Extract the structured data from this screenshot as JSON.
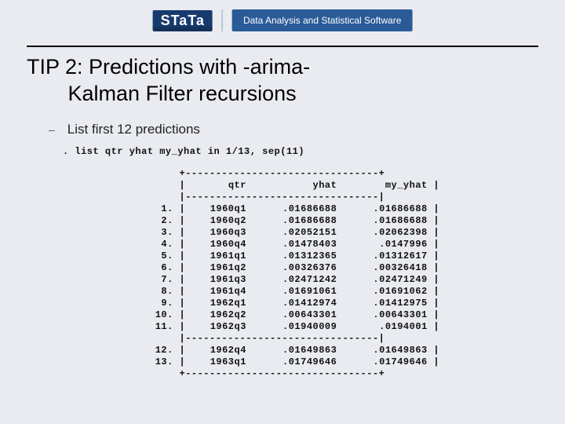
{
  "header": {
    "brand_upper": "STaTa",
    "tagline": "Data Analysis and Statistical Software"
  },
  "title_line1": "TIP 2: Predictions with -arima-",
  "title_line2": "Kalman Filter recursions",
  "bullet": "List first 12 predictions",
  "command": ". list qtr yhat my_yhat in 1/13, sep(11)",
  "table": {
    "border_top": "+--------------------------------+",
    "border_mid": "|--------------------------------|",
    "border_bot": "+--------------------------------+",
    "pipe": "|",
    "headers": {
      "qtr": "qtr",
      "yhat": "yhat",
      "my": "my_yhat"
    },
    "rows": [
      {
        "n": "1.",
        "qtr": "1960q1",
        "yhat": ".01686688",
        "my": ".01686688"
      },
      {
        "n": "2.",
        "qtr": "1960q2",
        "yhat": ".01686688",
        "my": ".01686688"
      },
      {
        "n": "3.",
        "qtr": "1960q3",
        "yhat": ".02052151",
        "my": ".02062398"
      },
      {
        "n": "4.",
        "qtr": "1960q4",
        "yhat": ".01478403",
        "my": ".0147996"
      },
      {
        "n": "5.",
        "qtr": "1961q1",
        "yhat": ".01312365",
        "my": ".01312617"
      },
      {
        "n": "6.",
        "qtr": "1961q2",
        "yhat": ".00326376",
        "my": ".00326418"
      },
      {
        "n": "7.",
        "qtr": "1961q3",
        "yhat": ".02471242",
        "my": ".02471249"
      },
      {
        "n": "8.",
        "qtr": "1961q4",
        "yhat": ".01691061",
        "my": ".01691062"
      },
      {
        "n": "9.",
        "qtr": "1962q1",
        "yhat": ".01412974",
        "my": ".01412975"
      },
      {
        "n": "10.",
        "qtr": "1962q2",
        "yhat": ".00643301",
        "my": ".00643301"
      },
      {
        "n": "11.",
        "qtr": "1962q3",
        "yhat": ".01940009",
        "my": ".0194001"
      },
      {
        "n": "12.",
        "qtr": "1962q4",
        "yhat": ".01649863",
        "my": ".01649863"
      },
      {
        "n": "13.",
        "qtr": "1963q1",
        "yhat": ".01749646",
        "my": ".01749646"
      }
    ],
    "sep_after": 11
  }
}
